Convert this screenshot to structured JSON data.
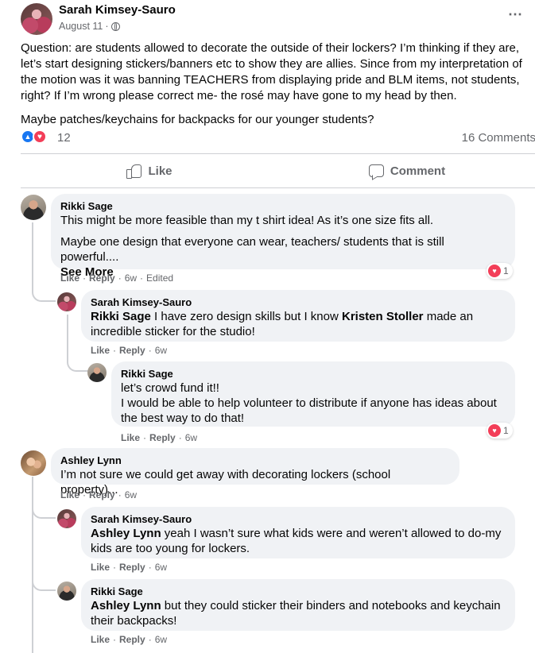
{
  "post": {
    "author": "Sarah Kimsey-Sauro",
    "date": "August 11",
    "date_separator": "·",
    "more_icon": "⋯",
    "paragraphs": [
      "Question: are students allowed to decorate the outside of their lockers? I’m thinking if they are, let’s start designing stickers/banners etc to show they are allies. Since from my interpretation of the motion was it was banning TEACHERS from displaying pride and BLM items, not students, right? If I’m wrong please correct me- the rosé may have gone to my head by then.",
      "Maybe patches/keychains for backpacks for our younger students?"
    ],
    "reaction_count": "12",
    "comments_label": "16 Comments",
    "like_label": "Like",
    "comment_label": "Comment"
  },
  "comments": [
    {
      "author": "Rikki Sage",
      "paragraphs": [
        "This might be more feasible than my t shirt idea! As it’s one size fits all.",
        "Maybe one design that everyone can wear, teachers/ students that is still powerful...."
      ],
      "see_more": "See More",
      "like": "Like",
      "reply": "Reply",
      "time": "6w",
      "edited": "Edited",
      "reactions": "1"
    },
    {
      "author": "Sarah Kimsey-Sauro",
      "mention": "Rikki Sage",
      "text": " I have zero design skills but I know ",
      "mention2": "Kristen Stoller",
      "text2": " made an incredible sticker for the studio!",
      "like": "Like",
      "reply": "Reply",
      "time": "6w"
    },
    {
      "author": "Rikki Sage",
      "lines": [
        "let’s crowd fund it!!",
        "I would be able to help volunteer to distribute if anyone has ideas about the best way to do that!"
      ],
      "like": "Like",
      "reply": "Reply",
      "time": "6w",
      "reactions": "1"
    },
    {
      "author": "Ashley Lynn",
      "text": "I’m not sure we could get away with decorating lockers (school property)...",
      "like": "Like",
      "reply": "Reply",
      "time": "6w"
    },
    {
      "author": "Sarah Kimsey-Sauro",
      "mention": "Ashley Lynn",
      "text": " yeah I wasn’t sure what kids were and weren’t allowed to do-my kids are too young for lockers.",
      "like": "Like",
      "reply": "Reply",
      "time": "6w"
    },
    {
      "author": "Rikki Sage",
      "mention": "Ashley Lynn",
      "text": " but they could sticker their binders and notebooks and keychain their backpacks!",
      "like": "Like",
      "reply": "Reply",
      "time": "6w"
    }
  ],
  "ui": {
    "dot": "·",
    "heart_glyph": "♥",
    "like_glyph": "👍",
    "accent": "#1877f2",
    "love_color": "#f33e58"
  }
}
